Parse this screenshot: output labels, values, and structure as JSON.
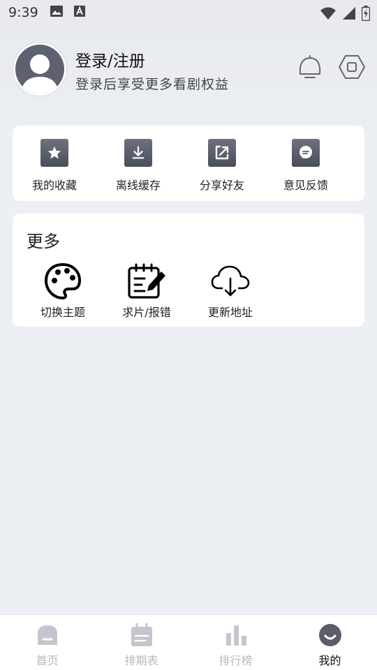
{
  "status_bar": {
    "time": "9:39",
    "icons": [
      "image-icon",
      "a-text-icon",
      "wifi-icon",
      "signal-icon",
      "battery-icon"
    ]
  },
  "profile": {
    "title": "登录/注册",
    "subtitle": "登录后享受更多看剧权益",
    "icons": [
      "notification-bell-icon",
      "settings-hexagon-icon"
    ]
  },
  "actions": [
    {
      "label": "我的收藏",
      "icon": "star-icon"
    },
    {
      "label": "离线缓存",
      "icon": "download-icon"
    },
    {
      "label": "分享好友",
      "icon": "share-icon"
    },
    {
      "label": "意见反馈",
      "icon": "feedback-icon"
    }
  ],
  "more": {
    "title": "更多",
    "items": [
      {
        "label": "切换主题",
        "icon": "palette-icon"
      },
      {
        "label": "求片/报错",
        "icon": "edit-note-icon"
      },
      {
        "label": "更新地址",
        "icon": "cloud-download-icon"
      }
    ]
  },
  "bottom_nav": {
    "items": [
      {
        "label": "首页",
        "icon": "home-icon",
        "active": false
      },
      {
        "label": "排期表",
        "icon": "calendar-icon",
        "active": false
      },
      {
        "label": "排行榜",
        "icon": "bar-chart-icon",
        "active": false
      },
      {
        "label": "我的",
        "icon": "smile-icon",
        "active": true
      }
    ]
  },
  "colors": {
    "background": "#eceff4",
    "card": "#ffffff",
    "icon_dark": "#555966",
    "nav_inactive": "#b5b8c0",
    "nav_active": "#111111"
  }
}
